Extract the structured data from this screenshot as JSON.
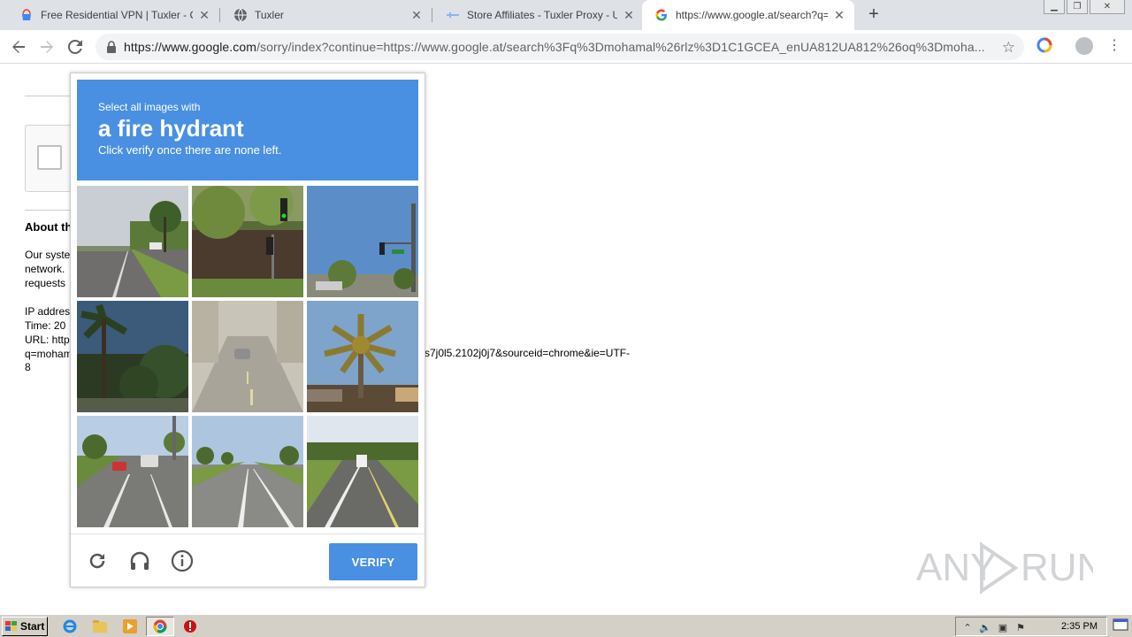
{
  "browser": {
    "tabs": [
      {
        "title": "Free Residential VPN | Tuxler - Chrome",
        "icon": "chrome-web-store-icon",
        "active": false
      },
      {
        "title": "Tuxler",
        "icon": "globe-icon",
        "active": false
      },
      {
        "title": "Store Affiliates - Tuxler Proxy - Unblock",
        "icon": "tuxler-icon",
        "active": false
      },
      {
        "title": "https://www.google.at/search?q=mohamal",
        "icon": "google-icon",
        "active": true
      }
    ],
    "new_tab": "+",
    "url_host": "https://www.google.com",
    "url_path": "/sorry/index?continue=https://www.google.at/search%3Fq%3Dmohamal%26rlz%3D1C1GCEA_enUA812UA812%26oq%3Dmoha..."
  },
  "page": {
    "about_title": "About this page",
    "para1": [
      "Our systems have detected unusual traffic from your computer",
      "network.",
      "requests"
    ],
    "info": [
      "IP address",
      "Time: 20",
      "URL: http",
      "q=moham"
    ],
    "url_tail": "s7j0l5.2102j0j7&sourceid=chrome&ie=UTF-",
    "last_line": "8"
  },
  "challenge": {
    "small_text": "Select all images with",
    "target": "a fire hydrant",
    "instruction": "Click verify once there are none left.",
    "verify_label": "VERIFY",
    "tiles": [
      {
        "name": "tile-road-palms"
      },
      {
        "name": "tile-traffic-light-wall"
      },
      {
        "name": "tile-traffic-light-sky"
      },
      {
        "name": "tile-palm-tree-dark"
      },
      {
        "name": "tile-foggy-street"
      },
      {
        "name": "tile-palm-tree-sunset"
      },
      {
        "name": "tile-road-cars"
      },
      {
        "name": "tile-wide-road"
      },
      {
        "name": "tile-road-truck"
      }
    ]
  },
  "taskbar": {
    "start_label": "Start",
    "clock": "2:35 PM"
  },
  "watermark": "ANY RUN",
  "colors": {
    "recaptcha_blue": "#4a90e2",
    "tabstrip": "#dee1e6",
    "taskbar": "#d4d0c8"
  }
}
